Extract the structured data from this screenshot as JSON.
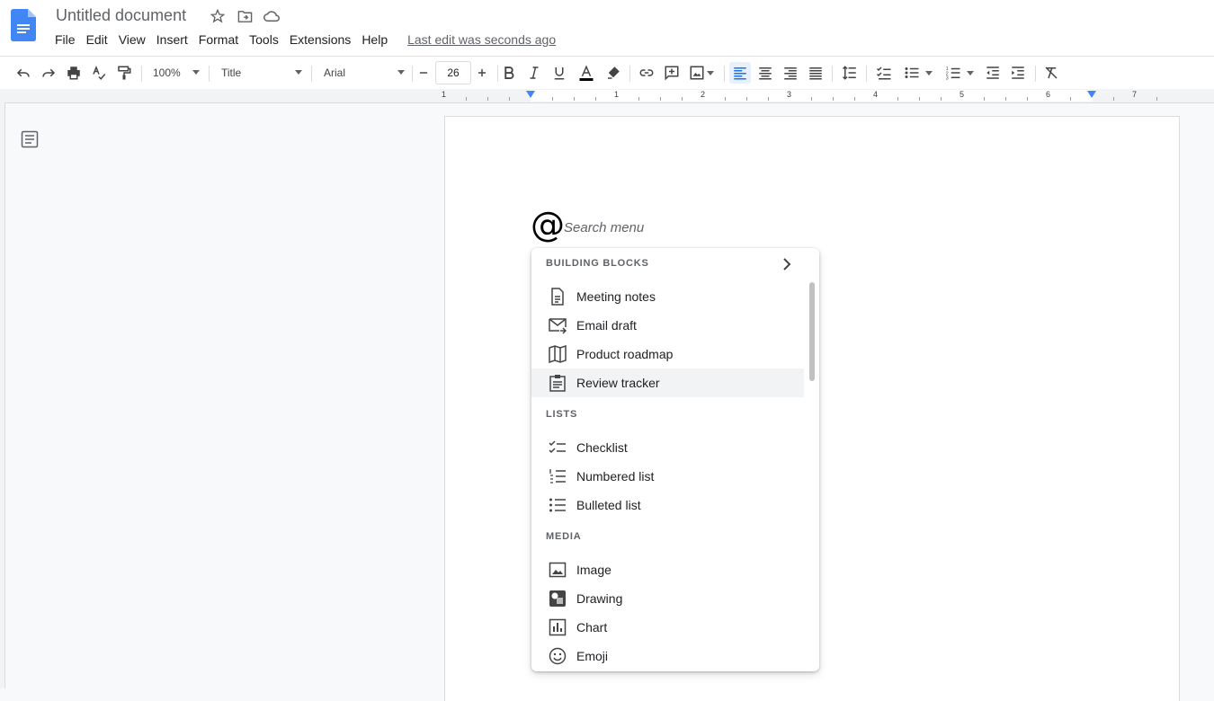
{
  "app": {
    "doc_title": "Untitled document",
    "menu": [
      "File",
      "Edit",
      "View",
      "Insert",
      "Format",
      "Tools",
      "Extensions",
      "Help"
    ],
    "last_edit": "Last edit was seconds ago"
  },
  "toolbar": {
    "zoom": "100%",
    "style": "Title",
    "font": "Arial",
    "font_size": "26"
  },
  "ruler": {
    "numbers": [
      "1",
      "1",
      "2",
      "3",
      "4",
      "5",
      "6",
      "7"
    ]
  },
  "editor": {
    "at_symbol": "@",
    "search_placeholder": "Search menu"
  },
  "dropdown": {
    "sections": [
      {
        "title": "BUILDING BLOCKS",
        "items": [
          {
            "label": "Meeting notes",
            "icon": "document-icon"
          },
          {
            "label": "Email draft",
            "icon": "email-icon"
          },
          {
            "label": "Product roadmap",
            "icon": "map-icon"
          },
          {
            "label": "Review tracker",
            "icon": "clipboard-icon",
            "highlighted": true
          }
        ]
      },
      {
        "title": "LISTS",
        "items": [
          {
            "label": "Checklist",
            "icon": "checklist-icon"
          },
          {
            "label": "Numbered list",
            "icon": "numbered-list-icon"
          },
          {
            "label": "Bulleted list",
            "icon": "bulleted-list-icon"
          }
        ]
      },
      {
        "title": "MEDIA",
        "items": [
          {
            "label": "Image",
            "icon": "image-icon"
          },
          {
            "label": "Drawing",
            "icon": "drawing-icon"
          },
          {
            "label": "Chart",
            "icon": "chart-icon"
          },
          {
            "label": "Emoji",
            "icon": "emoji-icon"
          }
        ]
      }
    ]
  },
  "colors": {
    "accent": "#1a73e8",
    "doc_blue": "#4285f4",
    "highlight": "#f1f3f4"
  }
}
